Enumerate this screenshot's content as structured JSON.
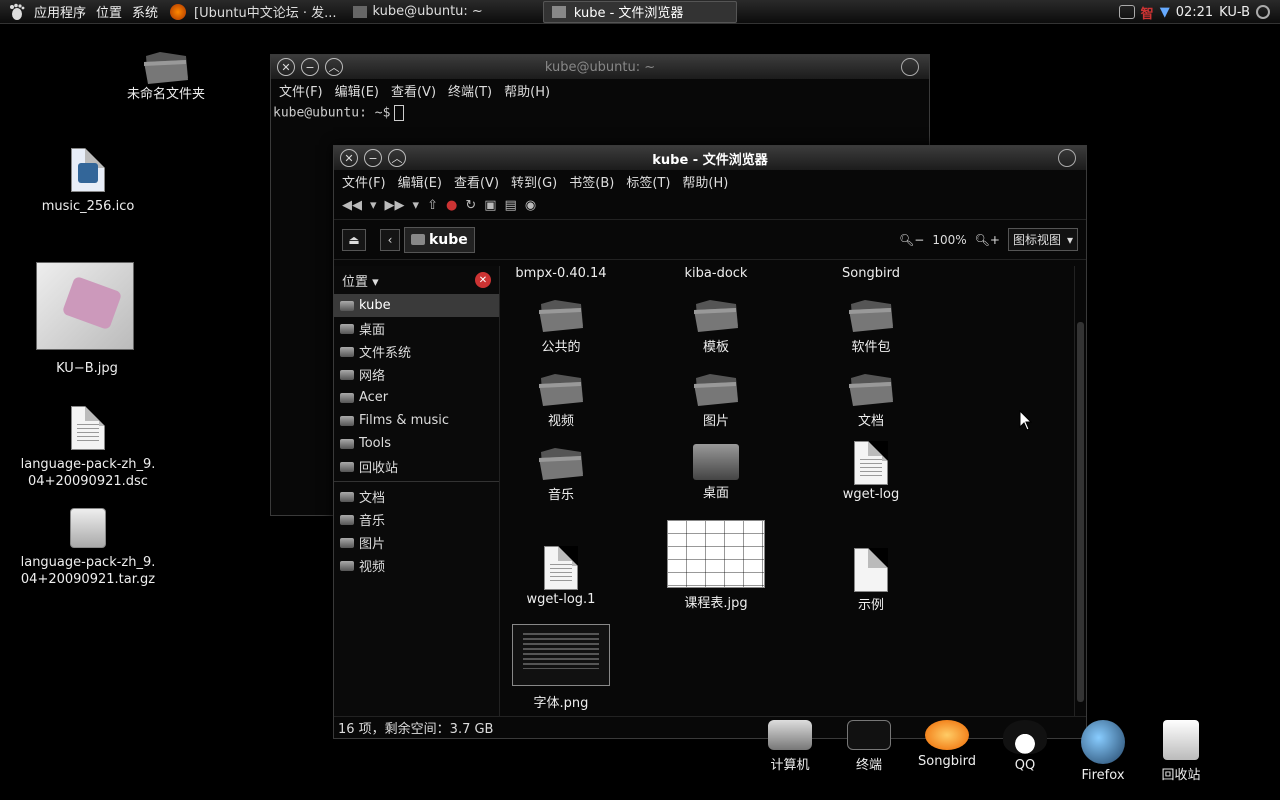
{
  "top_panel": {
    "menus": [
      "应用程序",
      "位置",
      "系统"
    ],
    "tasks": [
      {
        "label": "[Ubuntu中文论坛 · 发...",
        "active": false
      },
      {
        "label": "kube@ubuntu: ~",
        "active": false
      },
      {
        "label": "kube - 文件浏览器",
        "active": true
      }
    ],
    "clock": "02:21",
    "user": "KU-B"
  },
  "desktop_icons": [
    {
      "label": "未命名文件夹",
      "type": "folder"
    },
    {
      "label": "music_256.ico",
      "type": "image"
    },
    {
      "label": "KU−B.jpg",
      "type": "photo"
    },
    {
      "label": "language-pack-zh_9.04+20090921.dsc",
      "type": "doc"
    },
    {
      "label": "language-pack-zh_9.04+20090921.tar.gz",
      "type": "archive"
    }
  ],
  "terminal": {
    "title": "kube@ubuntu: ~",
    "menus": [
      "文件(F)",
      "编辑(E)",
      "查看(V)",
      "终端(T)",
      "帮助(H)"
    ],
    "prompt": "kube@ubuntu: ~$"
  },
  "nautilus": {
    "title": "kube - 文件浏览器",
    "menus": [
      "文件(F)",
      "编辑(E)",
      "查看(V)",
      "转到(G)",
      "书签(B)",
      "标签(T)",
      "帮助(H)"
    ],
    "crumb": "kube",
    "zoom": "100%",
    "view_mode": "图标视图",
    "sidebar_title": "位置",
    "places": [
      "kube",
      "桌面",
      "文件系统",
      "网络",
      "Acer",
      "Films & music",
      "Tools",
      "回收站"
    ],
    "bookmarks": [
      "文档",
      "音乐",
      "图片",
      "视频"
    ],
    "files": [
      {
        "label": "bmpx-0.40.14",
        "type": "label-only"
      },
      {
        "label": "kiba-dock",
        "type": "label-only"
      },
      {
        "label": "Songbird",
        "type": "label-only"
      },
      {
        "label": "公共的",
        "type": "folder"
      },
      {
        "label": "模板",
        "type": "folder"
      },
      {
        "label": "软件包",
        "type": "folder"
      },
      {
        "label": "视频",
        "type": "folder"
      },
      {
        "label": "图片",
        "type": "folder"
      },
      {
        "label": "文档",
        "type": "folder"
      },
      {
        "label": "音乐",
        "type": "folder"
      },
      {
        "label": "桌面",
        "type": "desktop-folder"
      },
      {
        "label": "wget-log",
        "type": "doc"
      },
      {
        "label": "wget-log.1",
        "type": "doc"
      },
      {
        "label": "课程表.jpg",
        "type": "image"
      },
      {
        "label": "示例",
        "type": "doc"
      },
      {
        "label": "字体.png",
        "type": "image"
      }
    ],
    "status": "16 项，剩余空间：3.7 GB"
  },
  "dock": [
    "计算机",
    "终端",
    "Songbird",
    "QQ",
    "Firefox",
    "回收站"
  ]
}
